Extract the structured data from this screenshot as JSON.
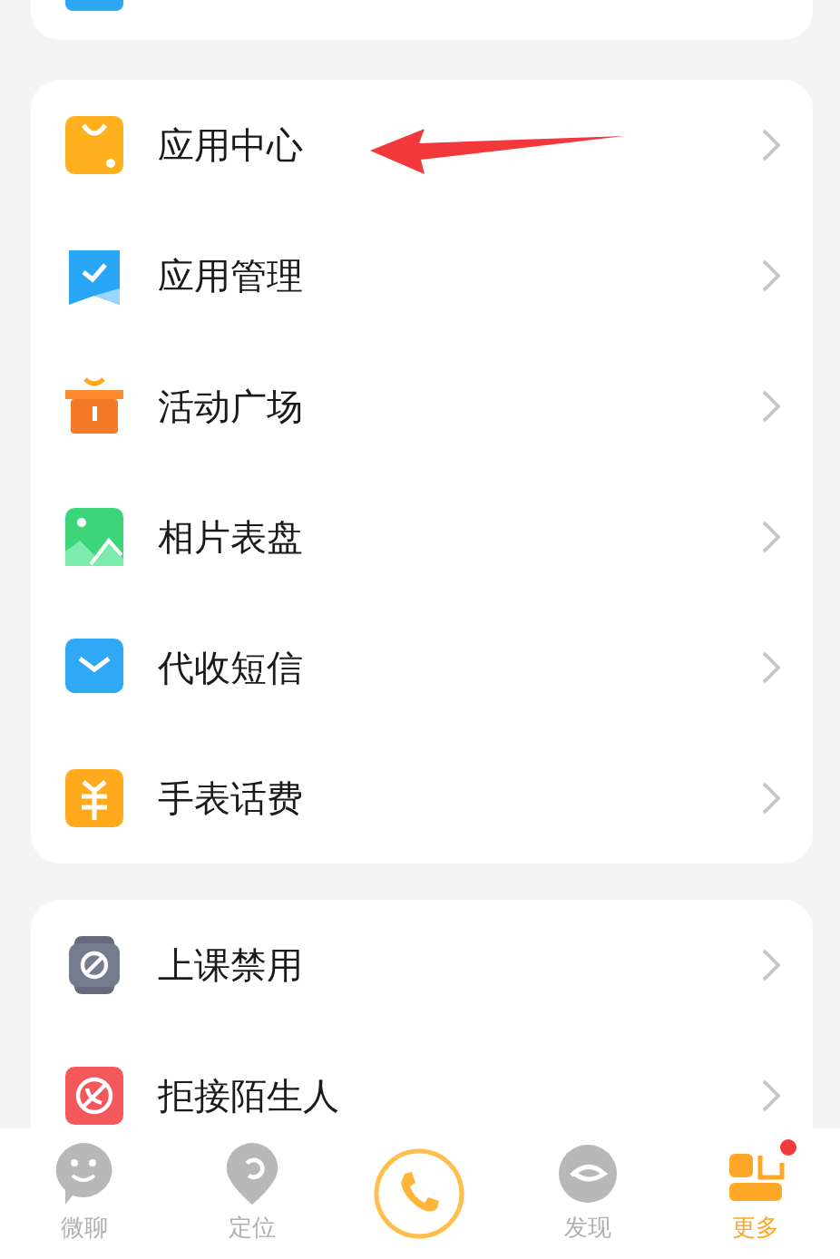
{
  "groups": [
    {
      "items": [
        {
          "kind": "partial"
        }
      ]
    },
    {
      "items": [
        {
          "kind": "bag",
          "label": "应用中心",
          "annotated": true
        },
        {
          "kind": "check",
          "label": "应用管理",
          "annotated": false
        },
        {
          "kind": "gift",
          "label": "活动广场",
          "annotated": false
        },
        {
          "kind": "photo",
          "label": "相片表盘",
          "annotated": false
        },
        {
          "kind": "mail",
          "label": "代收短信",
          "annotated": false
        },
        {
          "kind": "yuan",
          "label": "手表话费",
          "annotated": false
        }
      ]
    },
    {
      "items": [
        {
          "kind": "watch",
          "label": "上课禁用",
          "annotated": false
        },
        {
          "kind": "block",
          "label": "拒接陌生人",
          "annotated": false
        }
      ]
    }
  ],
  "nav": [
    {
      "kind": "chat",
      "label": "微聊",
      "selected": false,
      "badge": false
    },
    {
      "kind": "locate",
      "label": "定位",
      "selected": false,
      "badge": false
    },
    {
      "kind": "call",
      "selected": false,
      "badge": false
    },
    {
      "kind": "discover",
      "label": "发现",
      "selected": false,
      "badge": false
    },
    {
      "kind": "more",
      "label": "更多",
      "selected": true,
      "badge": true
    }
  ]
}
